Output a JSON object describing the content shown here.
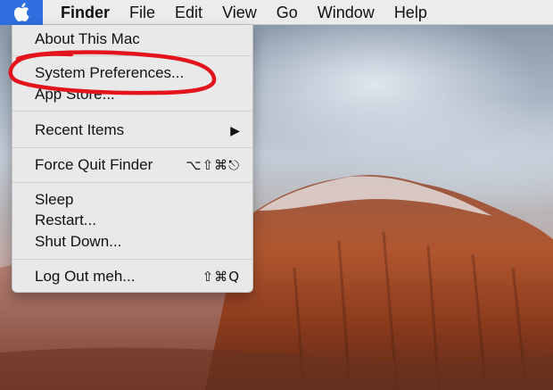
{
  "menubar": {
    "apple_icon": "apple-logo",
    "items": [
      {
        "label": "Finder"
      },
      {
        "label": "File"
      },
      {
        "label": "Edit"
      },
      {
        "label": "View"
      },
      {
        "label": "Go"
      },
      {
        "label": "Window"
      },
      {
        "label": "Help"
      }
    ]
  },
  "apple_menu": {
    "items": [
      {
        "label": "About This Mac"
      },
      {
        "label": "System Preferences..."
      },
      {
        "label": "App Store..."
      },
      {
        "label": "Recent Items",
        "submenu_icon": "triangle-right"
      },
      {
        "label": "Force Quit Finder",
        "shortcut": "⌥⇧⌘⎋"
      },
      {
        "label": "Sleep"
      },
      {
        "label": "Restart..."
      },
      {
        "label": "Shut Down..."
      },
      {
        "label": "Log Out meh...",
        "shortcut": "⇧⌘Q"
      }
    ]
  },
  "annotation": {
    "shape": "hand-drawn ellipse",
    "color": "#e3141b",
    "highlights": "System Preferences..."
  },
  "colors": {
    "menubar_bg": "#ececec",
    "apple_button_bg": "#2f6fdf",
    "menu_bg": "#e9e9e9"
  }
}
